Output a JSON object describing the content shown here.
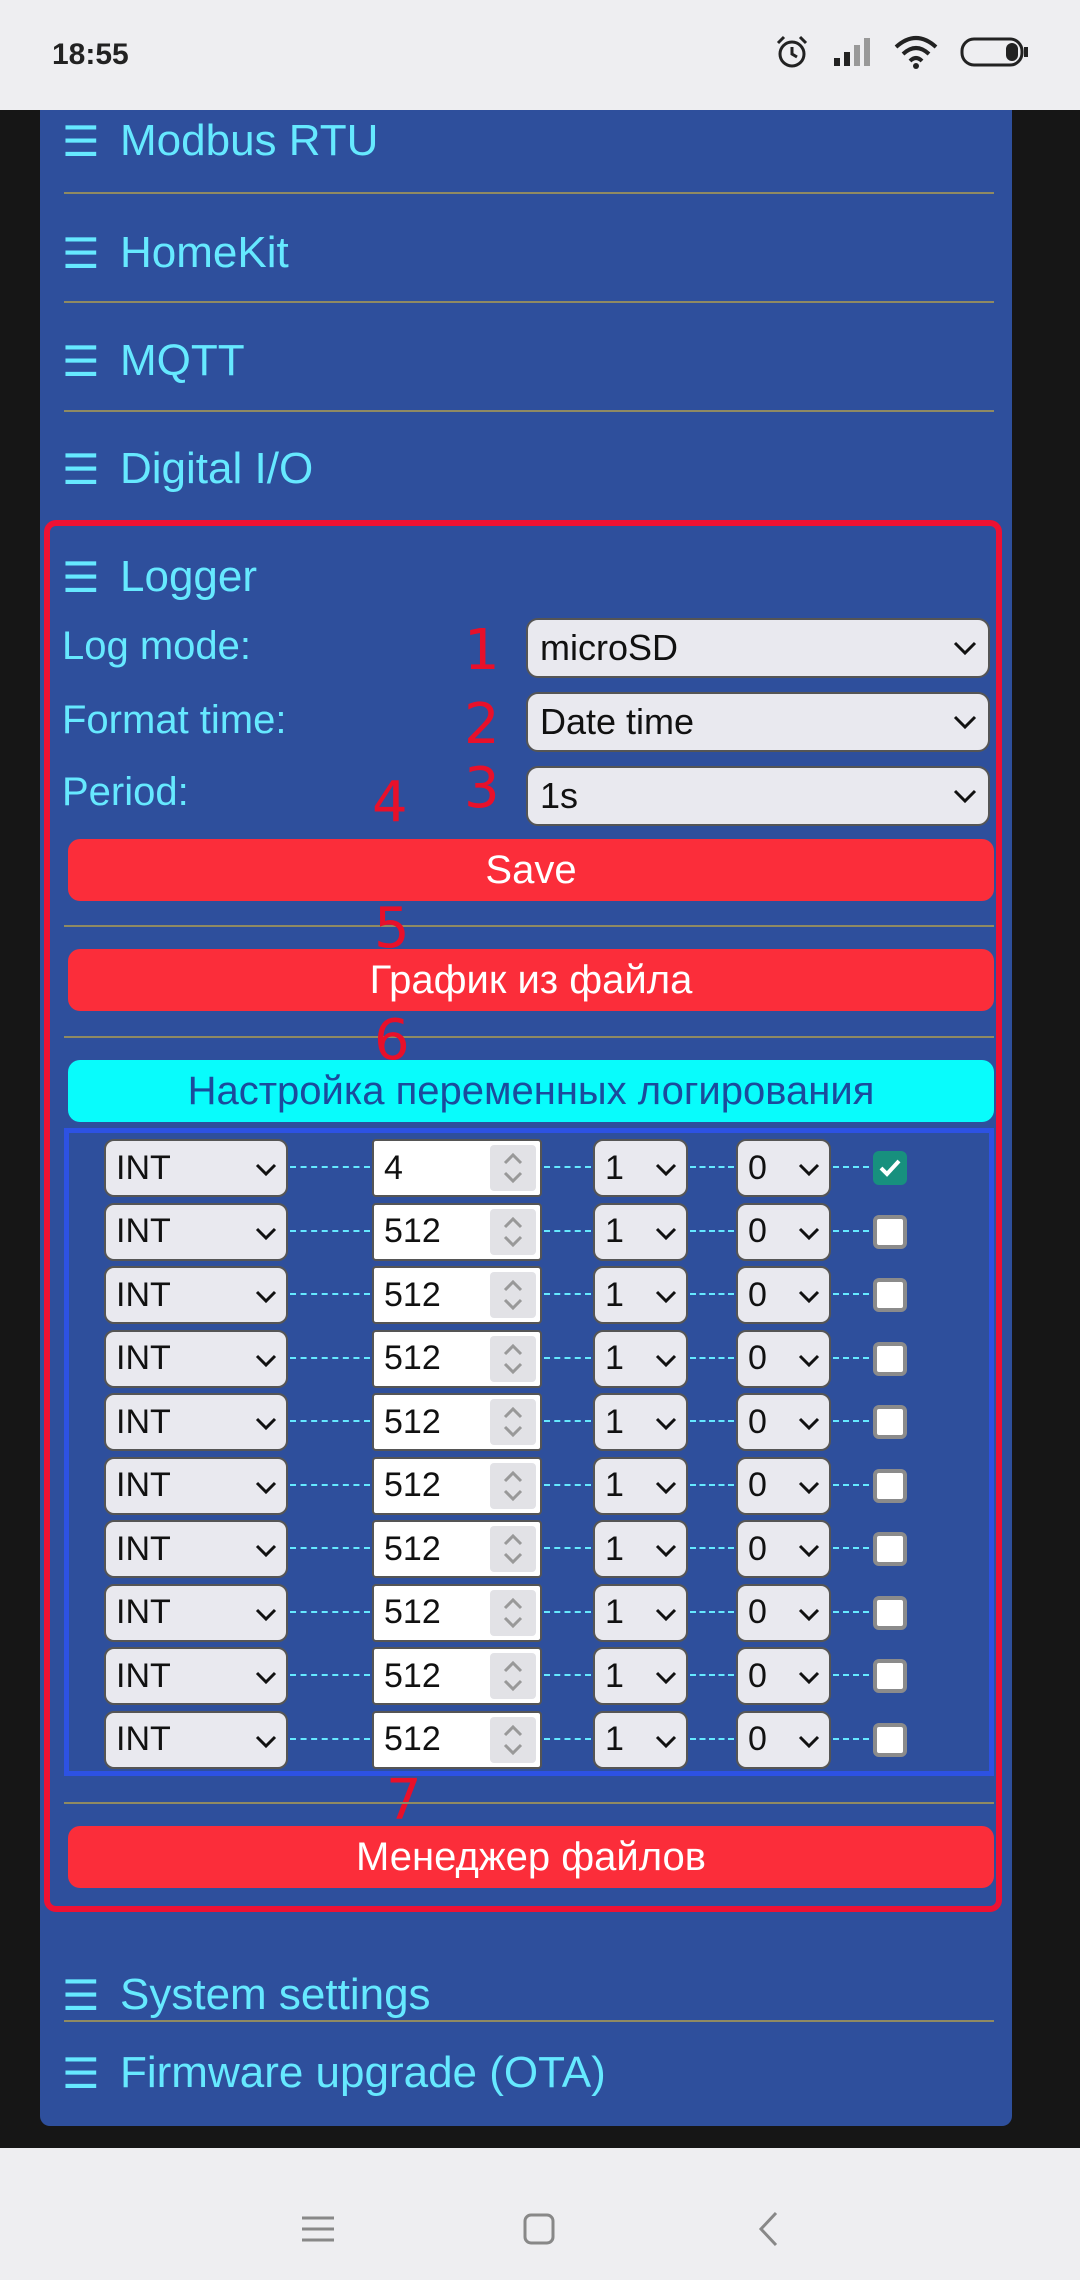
{
  "statusbar": {
    "time": "18:55",
    "icons": [
      "alarm-icon",
      "signal-icon",
      "wifi-icon",
      "battery-icon"
    ]
  },
  "sections_top": [
    {
      "label": "Modbus RTU"
    },
    {
      "label": "HomeKit"
    },
    {
      "label": "MQTT"
    },
    {
      "label": "Digital I/O"
    }
  ],
  "logger": {
    "title": "Logger",
    "log_mode_label": "Log mode:",
    "log_mode_value": "microSD",
    "format_time_label": "Format time:",
    "format_time_value": "Date time",
    "period_label": "Period:",
    "period_value": "1s",
    "save_button": "Save",
    "chart_button": "График из файла",
    "vars_button": "Настройка переменных логирования",
    "file_manager_button": "Менеджер файлов",
    "markers": [
      "1",
      "2",
      "3",
      "4",
      "5",
      "6",
      "7"
    ],
    "variables": [
      {
        "type": "INT",
        "address": "4",
        "s1": "1",
        "s2": "0",
        "checked": true
      },
      {
        "type": "INT",
        "address": "512",
        "s1": "1",
        "s2": "0",
        "checked": false
      },
      {
        "type": "INT",
        "address": "512",
        "s1": "1",
        "s2": "0",
        "checked": false
      },
      {
        "type": "INT",
        "address": "512",
        "s1": "1",
        "s2": "0",
        "checked": false
      },
      {
        "type": "INT",
        "address": "512",
        "s1": "1",
        "s2": "0",
        "checked": false
      },
      {
        "type": "INT",
        "address": "512",
        "s1": "1",
        "s2": "0",
        "checked": false
      },
      {
        "type": "INT",
        "address": "512",
        "s1": "1",
        "s2": "0",
        "checked": false
      },
      {
        "type": "INT",
        "address": "512",
        "s1": "1",
        "s2": "0",
        "checked": false
      },
      {
        "type": "INT",
        "address": "512",
        "s1": "1",
        "s2": "0",
        "checked": false
      },
      {
        "type": "INT",
        "address": "512",
        "s1": "1",
        "s2": "0",
        "checked": false
      }
    ]
  },
  "sections_bottom": [
    {
      "label": "System settings"
    },
    {
      "label": "Firmware upgrade (OTA)"
    }
  ],
  "colors": {
    "panel": "#2e4f9c",
    "accent_text": "#66e9ff",
    "red_button": "#fb2d3a",
    "cyan_button": "#08fcfc",
    "highlight_frame": "#ee1133",
    "checkbox_on": "#17907e"
  },
  "navbar": {
    "icons": [
      "menu-icon",
      "home-icon",
      "back-icon"
    ]
  }
}
